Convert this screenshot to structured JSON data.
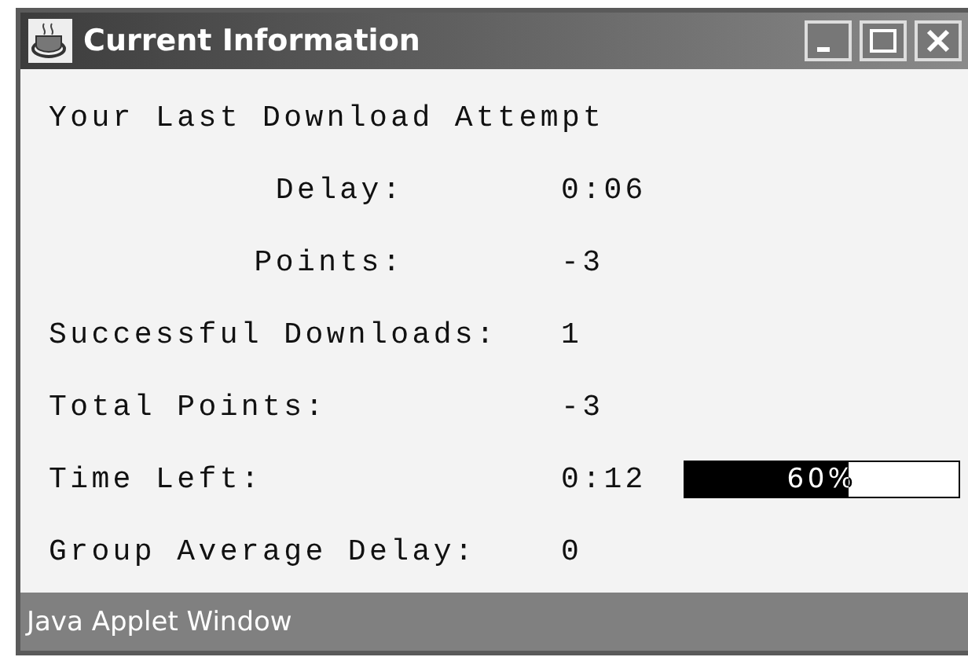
{
  "window": {
    "title": "Current Information"
  },
  "rows": [
    {
      "kind": "header",
      "label": "Your Last Download Attempt"
    },
    {
      "kind": "indented",
      "label": "Delay:",
      "value": "0:06"
    },
    {
      "kind": "indented",
      "label": "Points:",
      "value": "-3"
    },
    {
      "kind": "plain",
      "label": "Successful Downloads:",
      "value": "1"
    },
    {
      "kind": "plain",
      "label": "Total Points:",
      "value": "-3"
    },
    {
      "kind": "progress",
      "label": "Time Left:",
      "value": "0:12",
      "progress": {
        "level": 0.6,
        "text": "60%"
      }
    },
    {
      "kind": "plain",
      "label": "Group Average Delay:",
      "value": "0"
    }
  ],
  "status_bar": "Java Applet Window"
}
